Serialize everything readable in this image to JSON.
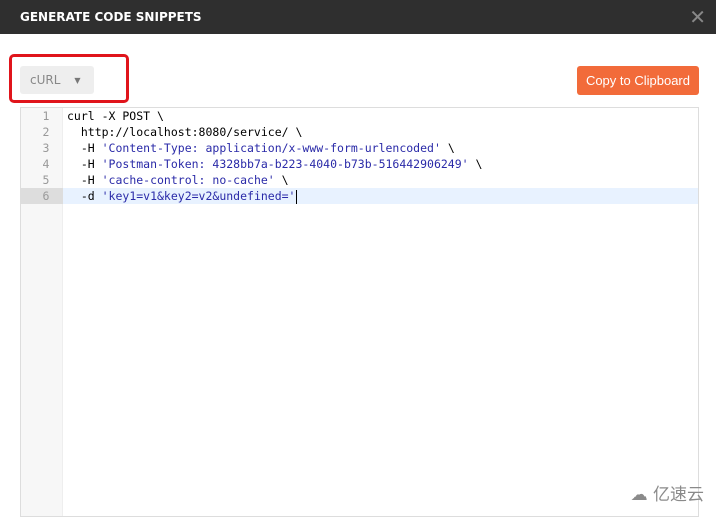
{
  "header": {
    "title": "GENERATE CODE SNIPPETS",
    "close_icon": "close-icon"
  },
  "language_select": {
    "value": "cURL"
  },
  "copy_button": {
    "label": "Copy to Clipboard"
  },
  "colors": {
    "accent": "#f26b3a",
    "header_bg": "#2f2f2f",
    "highlight_box": "#e0141b"
  },
  "editor": {
    "active_line": 6,
    "lines": [
      {
        "num": "1",
        "parts": [
          {
            "t": "curl -X POST \\",
            "c": ""
          }
        ]
      },
      {
        "num": "2",
        "parts": [
          {
            "t": "  http://localhost:8080/service/ \\",
            "c": ""
          }
        ]
      },
      {
        "num": "3",
        "parts": [
          {
            "t": "  -H ",
            "c": ""
          },
          {
            "t": "'Content-Type: application/x-www-form-urlencoded'",
            "c": "str"
          },
          {
            "t": " \\",
            "c": ""
          }
        ]
      },
      {
        "num": "4",
        "parts": [
          {
            "t": "  -H ",
            "c": ""
          },
          {
            "t": "'Postman-Token: 4328bb7a-b223-4040-b73b-516442906249'",
            "c": "str"
          },
          {
            "t": " \\",
            "c": ""
          }
        ]
      },
      {
        "num": "5",
        "parts": [
          {
            "t": "  -H ",
            "c": ""
          },
          {
            "t": "'cache-control: no-cache'",
            "c": "str"
          },
          {
            "t": " \\",
            "c": ""
          }
        ]
      },
      {
        "num": "6",
        "parts": [
          {
            "t": "  -d ",
            "c": ""
          },
          {
            "t": "'key1=v1&key2=v2&undefined='",
            "c": "str"
          }
        ]
      }
    ]
  },
  "watermark": {
    "text": "亿速云"
  }
}
